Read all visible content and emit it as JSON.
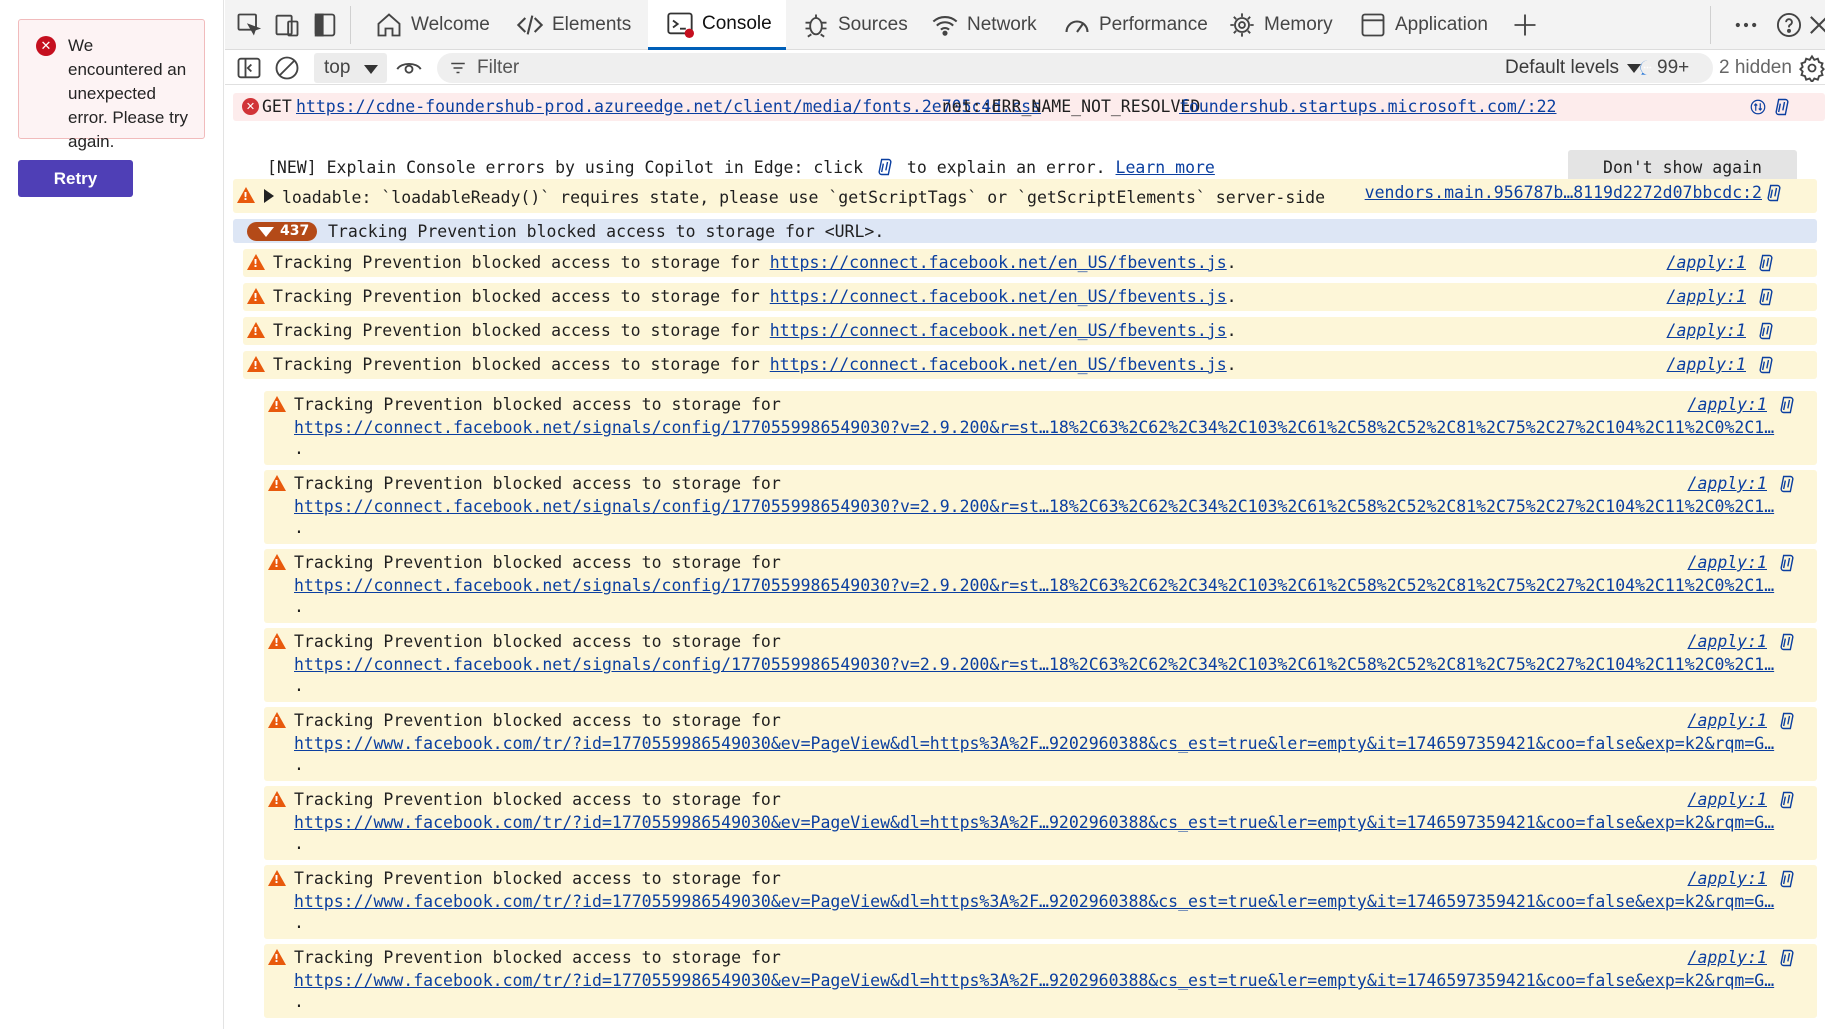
{
  "app": {
    "error_message": "We encountered an unexpected error. Please try again.",
    "retry_label": "Retry"
  },
  "tabs": [
    {
      "label": "Welcome",
      "icon": "home-icon"
    },
    {
      "label": "Elements",
      "icon": "code-icon"
    },
    {
      "label": "Console",
      "icon": "console-icon",
      "active": true
    },
    {
      "label": "Sources",
      "icon": "bug-icon"
    },
    {
      "label": "Network",
      "icon": "wifi-icon"
    },
    {
      "label": "Performance",
      "icon": "gauge-icon"
    },
    {
      "label": "Memory",
      "icon": "chip-icon"
    },
    {
      "label": "Application",
      "icon": "window-icon"
    }
  ],
  "toolbar": {
    "context": "top",
    "filter_placeholder": "Filter",
    "levels": "Default levels",
    "issues_count": "99+",
    "hidden_count": "2 hidden"
  },
  "console": {
    "error": {
      "method": "GET",
      "url": "https://cdne-foundershub-prod.azureedge.net/client/media/fonts.2e705c4d.css",
      "status": "net::ERR_NAME_NOT_RESOLVED",
      "source": "foundershub.startups.microsoft.com/:22"
    },
    "notice": {
      "before": "[NEW] Explain Console errors by using Copilot in Edge: click",
      "after": "to explain an error.",
      "link": "Learn more",
      "dismiss": "Don't show again"
    },
    "loadable_warning": {
      "text": "loadable: `loadableReady()` requires state, please use `getScriptTags` or `getScriptElements` server-side",
      "source": "vendors.main.956787b…8119d2272d07bbcdc:2"
    },
    "group": {
      "count": "437",
      "text": "Tracking Prevention blocked access to storage for <URL>."
    },
    "short_warnings": [
      {
        "prefix": "Tracking Prevention blocked access to storage for",
        "url": "https://connect.facebook.net/en_US/fbevents.js",
        "source": "/apply:1"
      },
      {
        "prefix": "Tracking Prevention blocked access to storage for",
        "url": "https://connect.facebook.net/en_US/fbevents.js",
        "source": "/apply:1"
      },
      {
        "prefix": "Tracking Prevention blocked access to storage for",
        "url": "https://connect.facebook.net/en_US/fbevents.js",
        "source": "/apply:1"
      },
      {
        "prefix": "Tracking Prevention blocked access to storage for",
        "url": "https://connect.facebook.net/en_US/fbevents.js",
        "source": "/apply:1"
      }
    ],
    "long_warnings": [
      {
        "prefix": "Tracking Prevention blocked access to storage for",
        "url": "https://connect.facebook.net/signals/config/1770559986549030?v=2.9.200&r=st…18%2C63%2C62%2C34%2C103%2C61%2C58%2C52%2C81%2C75%2C27%2C104%2C11%2C0%2C1…",
        "source": "/apply:1"
      },
      {
        "prefix": "Tracking Prevention blocked access to storage for",
        "url": "https://connect.facebook.net/signals/config/1770559986549030?v=2.9.200&r=st…18%2C63%2C62%2C34%2C103%2C61%2C58%2C52%2C81%2C75%2C27%2C104%2C11%2C0%2C1…",
        "source": "/apply:1"
      },
      {
        "prefix": "Tracking Prevention blocked access to storage for",
        "url": "https://connect.facebook.net/signals/config/1770559986549030?v=2.9.200&r=st…18%2C63%2C62%2C34%2C103%2C61%2C58%2C52%2C81%2C75%2C27%2C104%2C11%2C0%2C1…",
        "source": "/apply:1"
      },
      {
        "prefix": "Tracking Prevention blocked access to storage for",
        "url": "https://connect.facebook.net/signals/config/1770559986549030?v=2.9.200&r=st…18%2C63%2C62%2C34%2C103%2C61%2C58%2C52%2C81%2C75%2C27%2C104%2C11%2C0%2C1…",
        "source": "/apply:1"
      },
      {
        "prefix": "Tracking Prevention blocked access to storage for",
        "url": "https://www.facebook.com/tr/?id=1770559986549030&ev=PageView&dl=https%3A%2F…9202960388&cs_est=true&ler=empty&it=1746597359421&coo=false&exp=k2&rqm=G…",
        "source": "/apply:1"
      },
      {
        "prefix": "Tracking Prevention blocked access to storage for",
        "url": "https://www.facebook.com/tr/?id=1770559986549030&ev=PageView&dl=https%3A%2F…9202960388&cs_est=true&ler=empty&it=1746597359421&coo=false&exp=k2&rqm=G…",
        "source": "/apply:1"
      },
      {
        "prefix": "Tracking Prevention blocked access to storage for",
        "url": "https://www.facebook.com/tr/?id=1770559986549030&ev=PageView&dl=https%3A%2F…9202960388&cs_est=true&ler=empty&it=1746597359421&coo=false&exp=k2&rqm=G…",
        "source": "/apply:1"
      },
      {
        "prefix": "Tracking Prevention blocked access to storage for",
        "url": "https://www.facebook.com/tr/?id=1770559986549030&ev=PageView&dl=https%3A%2F…9202960388&cs_est=true&ler=empty&it=1746597359421&coo=false&exp=k2&rqm=G…",
        "source": "/apply:1"
      }
    ]
  },
  "colors": {
    "accent": "#4f3fb6",
    "error_bg": "#fdecec",
    "warning_bg": "#fdf6d8",
    "warning_icon": "#e8590c",
    "link": "#0b3fa0"
  }
}
